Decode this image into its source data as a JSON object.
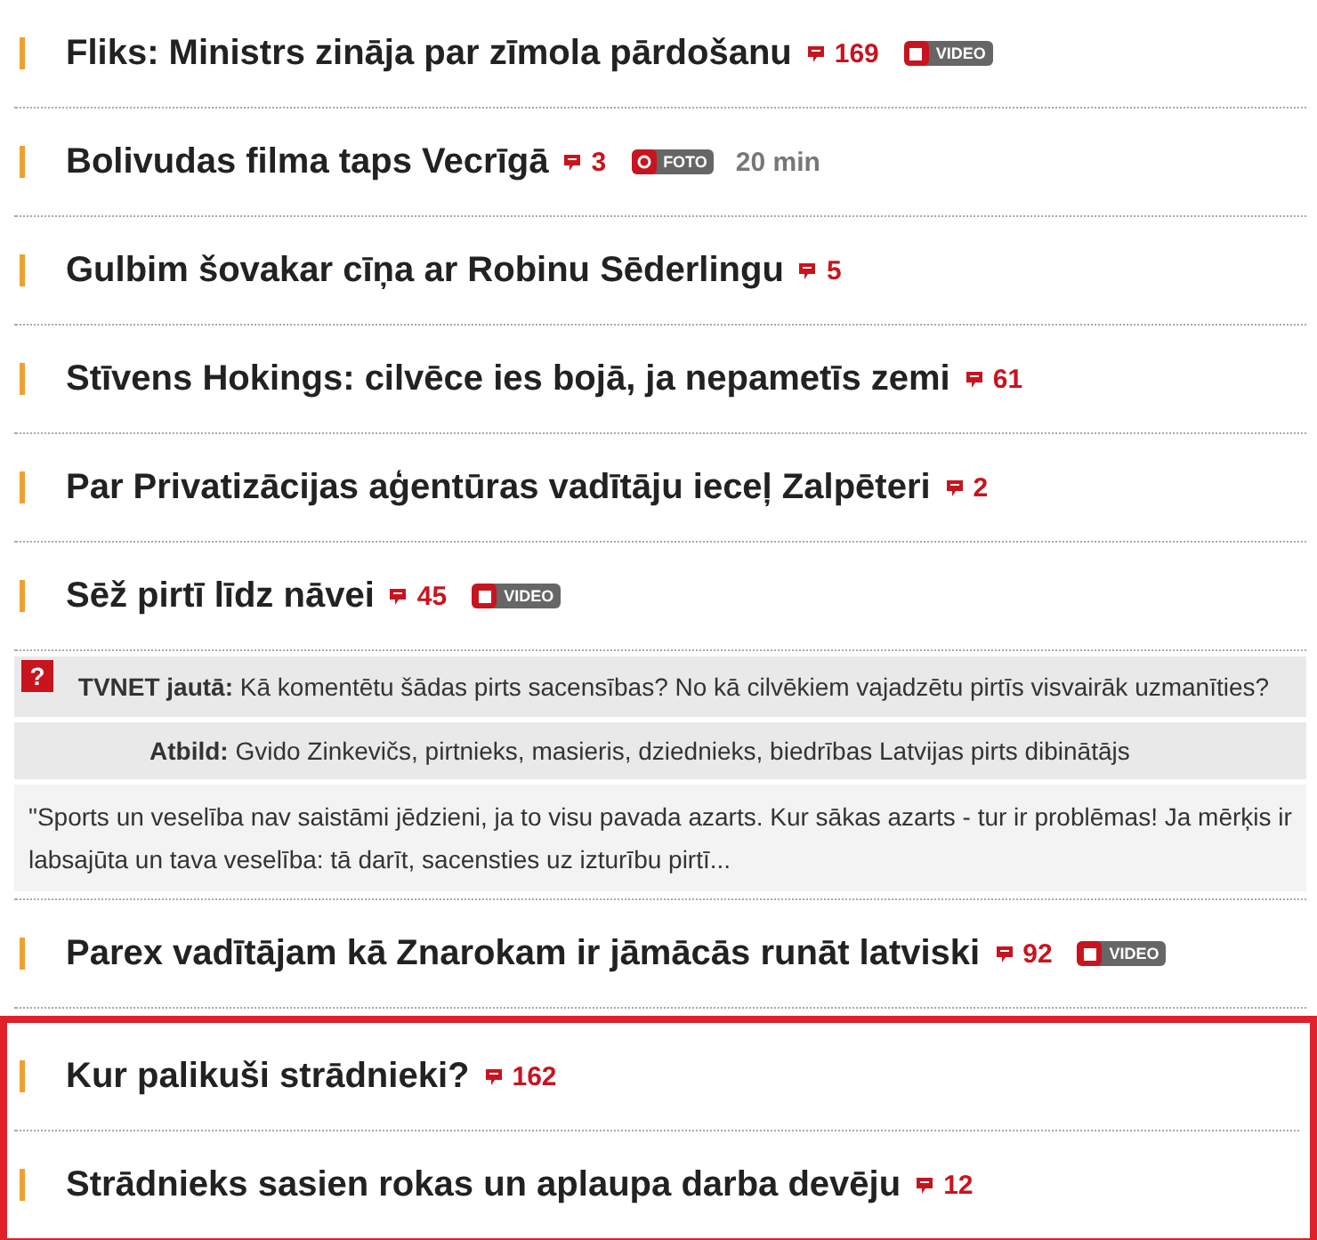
{
  "headlines": [
    {
      "title": "Fliks: Ministrs zināja par zīmola pārdošanu",
      "comments": "169",
      "badge": {
        "kind": "video",
        "label": "VIDEO"
      }
    },
    {
      "title": "Bolivudas filma taps Vecrīgā",
      "comments": "3",
      "badge": {
        "kind": "photo",
        "label": "FOTO"
      },
      "time": "20 min"
    },
    {
      "title": "Gulbim šovakar cīņa ar Robinu Sēderlingu",
      "comments": "5"
    },
    {
      "title": "Stīvens Hokings: cilvēce ies bojā, ja nepametīs zemi",
      "comments": "61"
    },
    {
      "title": "Par Privatizācijas aģentūras vadītāju ieceļ Zalpēteri",
      "comments": "2"
    },
    {
      "title": "Sēž pirtī līdz nāvei",
      "comments": "45",
      "badge": {
        "kind": "video",
        "label": "VIDEO"
      }
    }
  ],
  "poll": {
    "icon": "?",
    "question": "**TVNET jautā:** Kā komentētu šādas pirts sacensības? No kā cilvēkiem vajadzētu pirtīs visvairāk uzmanīties?",
    "answer": "**Atbild:** Gvido Zinkevičs, pirtnieks, masieris, dziednieks, biedrības Latvijas pirts dibinātājs",
    "quote": "\"Sports un veselība nav saistāmi jēdzieni, ja to visu pavada azarts. Kur sākas azarts - tur ir problēmas! Ja mērķis ir labsajūta un tava veselība: tā darīt, sacensties uz izturību pirtī..."
  },
  "headlines_after": [
    {
      "title": "Parex vadītājam kā Znarokam ir jāmācās runāt latviski",
      "comments": "92",
      "badge": {
        "kind": "video",
        "label": "VIDEO"
      }
    }
  ],
  "highlighted_group": [
    {
      "title": "Kur palikuši strādnieki?",
      "comments": "162"
    },
    {
      "title": "Strādnieks sasien rokas un aplaupa darba devēju",
      "comments": "12"
    }
  ]
}
